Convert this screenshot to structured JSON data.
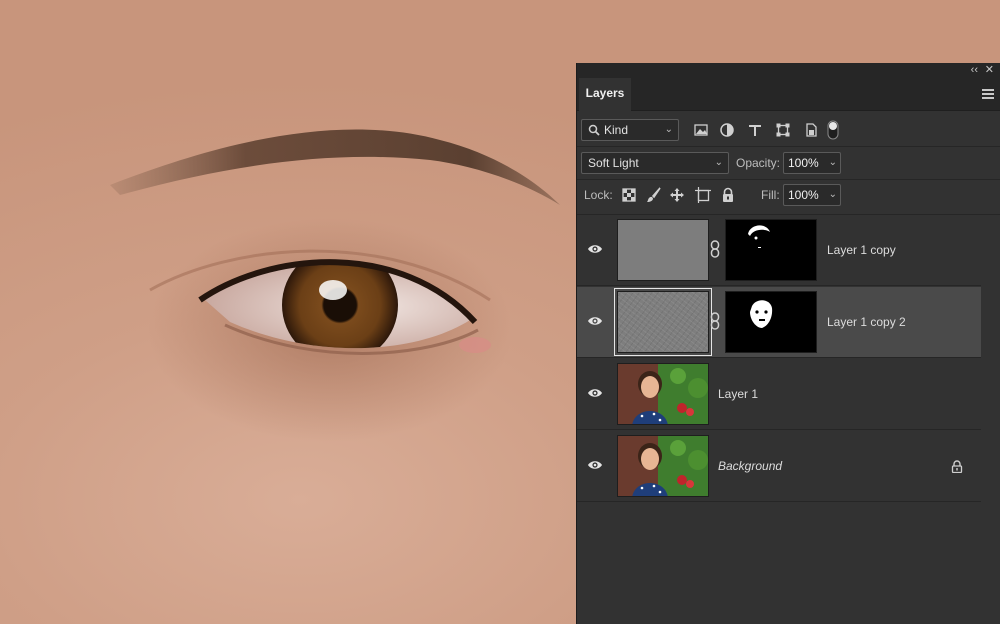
{
  "panel": {
    "tab_label": "Layers",
    "collapse_glyph": "‹‹",
    "close_glyph": "✕",
    "filter": {
      "kind_label": "Kind",
      "icons": [
        "image-filter-icon",
        "adjustment-filter-icon",
        "type-filter-icon",
        "shape-filter-icon",
        "smart-object-filter-icon",
        "filter-toggle-icon"
      ]
    },
    "blend_mode": "Soft Light",
    "opacity_label": "Opacity:",
    "opacity_value": "100%",
    "lock_label": "Lock:",
    "lock_icons": [
      "lock-transparent-pixels-icon",
      "lock-image-pixels-icon",
      "lock-position-icon",
      "lock-artboard-icon",
      "lock-all-icon"
    ],
    "fill_label": "Fill:",
    "fill_value": "100%",
    "chevron": "⌄"
  },
  "layers": [
    {
      "name": "Layer 1 copy",
      "visible": true,
      "selected": false,
      "has_mask": true,
      "thumb": "gray"
    },
    {
      "name": "Layer 1 copy 2",
      "visible": true,
      "selected": true,
      "has_mask": true,
      "thumb": "noise"
    },
    {
      "name": "Layer 1",
      "visible": true,
      "selected": false,
      "has_mask": false,
      "thumb": "photo"
    },
    {
      "name": "Background",
      "visible": true,
      "selected": false,
      "has_mask": false,
      "thumb": "photo",
      "locked": true
    }
  ],
  "colors": {
    "panel_bg": "#323232",
    "selected_layer_bg": "#4a4a4a",
    "skin": "#d2a48c",
    "iris": "#6b3f16"
  }
}
